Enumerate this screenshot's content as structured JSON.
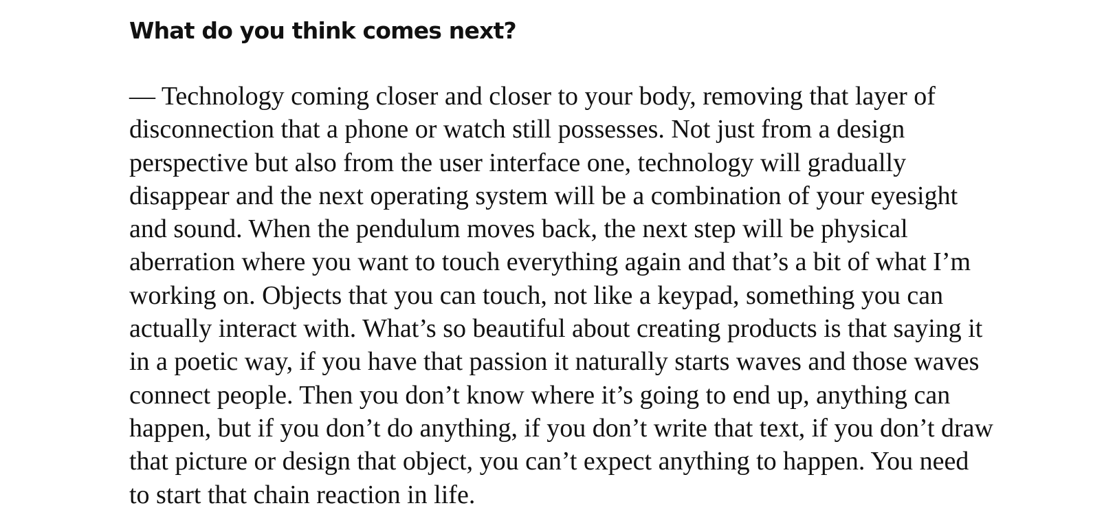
{
  "interview": {
    "question": "What do you think comes next?",
    "answer": "— Technology coming closer and closer to your body, removing that layer of disconnection that a phone or watch still possesses. Not just from a design perspective but also from the user interface one, technology will gradually disappear and the next operating system will be a combination of your eyesight and sound. When the pendulum moves back, the next step will be physical aberration where you want to touch everything again and that’s a bit of what I’m working on. Objects that you can touch, not like a keypad, something you can actually interact with. What’s so beautiful about creating products is that saying it in a poetic way, if you have that passion it naturally starts waves and those waves connect people. Then you don’t know where it’s going to end up, anything can happen, but if you don’t do anything, if you don’t write that text, if you don’t draw that picture or design that object, you can’t expect anything to happen. You need to start that chain reaction in life."
  }
}
